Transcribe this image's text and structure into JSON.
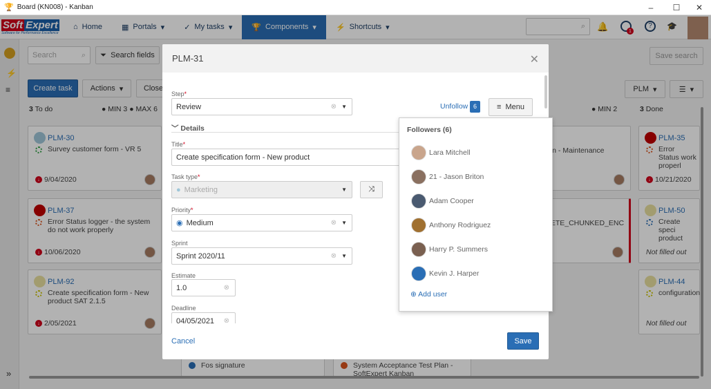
{
  "window": {
    "title": "Board (KN008) - Kanban",
    "controls": [
      "–",
      "☐",
      "✕"
    ]
  },
  "nav": {
    "logo": {
      "part1": "Soft",
      "part2": "Expert",
      "tagline": "Software for Performance Excellence"
    },
    "items": [
      {
        "label": "Home",
        "icon": "home-icon"
      },
      {
        "label": "Portals",
        "icon": "grid-icon"
      },
      {
        "label": "My tasks",
        "icon": "check-icon"
      },
      {
        "label": "Components",
        "icon": "trophy-icon",
        "active": true
      },
      {
        "label": "Shortcuts",
        "icon": "bolt-icon"
      }
    ],
    "notification_count": "1"
  },
  "toolbar": {
    "search_placeholder": "Search",
    "search_fields": "Search fields",
    "save_search": "Save search",
    "create_task": "Create task",
    "actions": "Actions",
    "close": "Close",
    "plm": "PLM"
  },
  "columns": [
    {
      "count": "3",
      "name": "To do",
      "min": "MIN 3",
      "max": "MAX 6"
    },
    {
      "min": "MIN 2"
    },
    {
      "count": "3",
      "name": "Done"
    }
  ],
  "cards_todo": [
    {
      "id": "PLM-30",
      "text": "Survey customer form - VR 5",
      "date": "9/04/2020",
      "status_color": "#2ea043",
      "icon_color": "#9fc6d8"
    },
    {
      "id": "PLM-37",
      "text": "Error Status logger - the system do not work properly",
      "date": "10/06/2020",
      "status_color": "#d9541e",
      "icon_color": "#c00000"
    },
    {
      "id": "PLM-92",
      "text": "Create specification form - New product SAT 2.1.5",
      "date": "2/05/2021",
      "status_color": "#c8c000",
      "icon_color": "#e8e0a0"
    }
  ],
  "cards_mid": [
    {
      "text": "lan - Maintenance"
    },
    {
      "text": "LETE_CHUNKED_ENC"
    }
  ],
  "cards_done": [
    {
      "id": "PLM-35",
      "text": "Error Status work properl",
      "date": "10/21/2020",
      "status_color": "#d9541e",
      "icon_color": "#c00000"
    },
    {
      "id": "PLM-50",
      "text": "Create speci product",
      "date": "Not filled out",
      "status_color": "#2a6eb5",
      "icon_color": "#e8e0a0"
    },
    {
      "id": "PLM-44",
      "text": "configuration",
      "date": "Not filled out",
      "status_color": "#c8c000",
      "icon_color": "#e8e0a0"
    }
  ],
  "bottom_cards": [
    {
      "text": "Fos signature"
    },
    {
      "text": "System Acceptance Test Plan - SoftExpert Kanban"
    }
  ],
  "modal": {
    "title": "PLM-31",
    "step_label": "Step",
    "step": "Review",
    "unfollow": "Unfollow",
    "followers_count": "6",
    "menu": "Menu",
    "details": "Details",
    "title_label": "Title",
    "title_value": "Create specification form - New product",
    "task_type_label": "Task type",
    "task_type": "Marketing",
    "priority_label": "Priority",
    "priority": "Medium",
    "sprint_label": "Sprint",
    "sprint": "Sprint 2020/11",
    "estimate_label": "Estimate",
    "estimate": "1.0",
    "deadline_label": "Deadline",
    "deadline": "04/05/2021",
    "cancel": "Cancel",
    "save": "Save"
  },
  "followers": {
    "title": "Followers (6)",
    "users": [
      "Lara Mitchell",
      "21 - Jason Briton",
      "Adam Cooper",
      "Anthony Rodriguez",
      "Harry P. Summers",
      "Kevin J. Harper"
    ],
    "add": "Add user"
  },
  "colors": {
    "accent": "#2a6eb5",
    "danger": "#d0021b"
  }
}
